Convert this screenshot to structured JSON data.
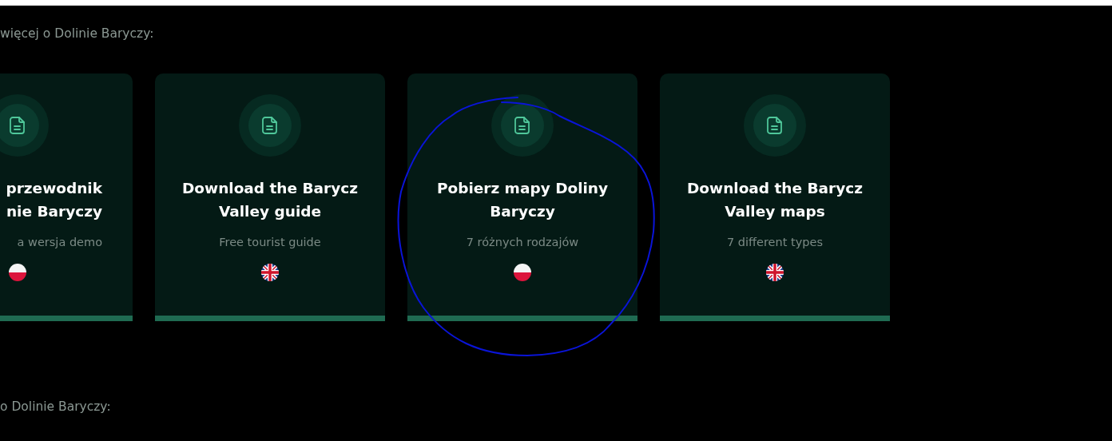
{
  "sections": [
    {
      "heading": "więcej o Dolinie Baryczy:",
      "cards": [
        {
          "kind": "cut",
          "title": "przewodnik\nnie Baryczy",
          "subtitle": "a wersja demo",
          "flag": {
            "kind": "polish"
          }
        },
        {
          "kind": "full",
          "title": "Download the Barycz Valley guide",
          "subtitle": "Free tourist guide",
          "flag": {
            "kind": "british"
          }
        },
        {
          "kind": "full",
          "title": "Pobierz mapy Doliny Baryczy",
          "subtitle": "7 różnych rodzajów",
          "flag": {
            "kind": "polish"
          }
        },
        {
          "kind": "full",
          "title": "Download the Barycz Valley maps",
          "subtitle": "7 different types",
          "flag": {
            "kind": "british"
          }
        }
      ]
    },
    {
      "heading": "o Dolinie Baryczy:"
    }
  ]
}
